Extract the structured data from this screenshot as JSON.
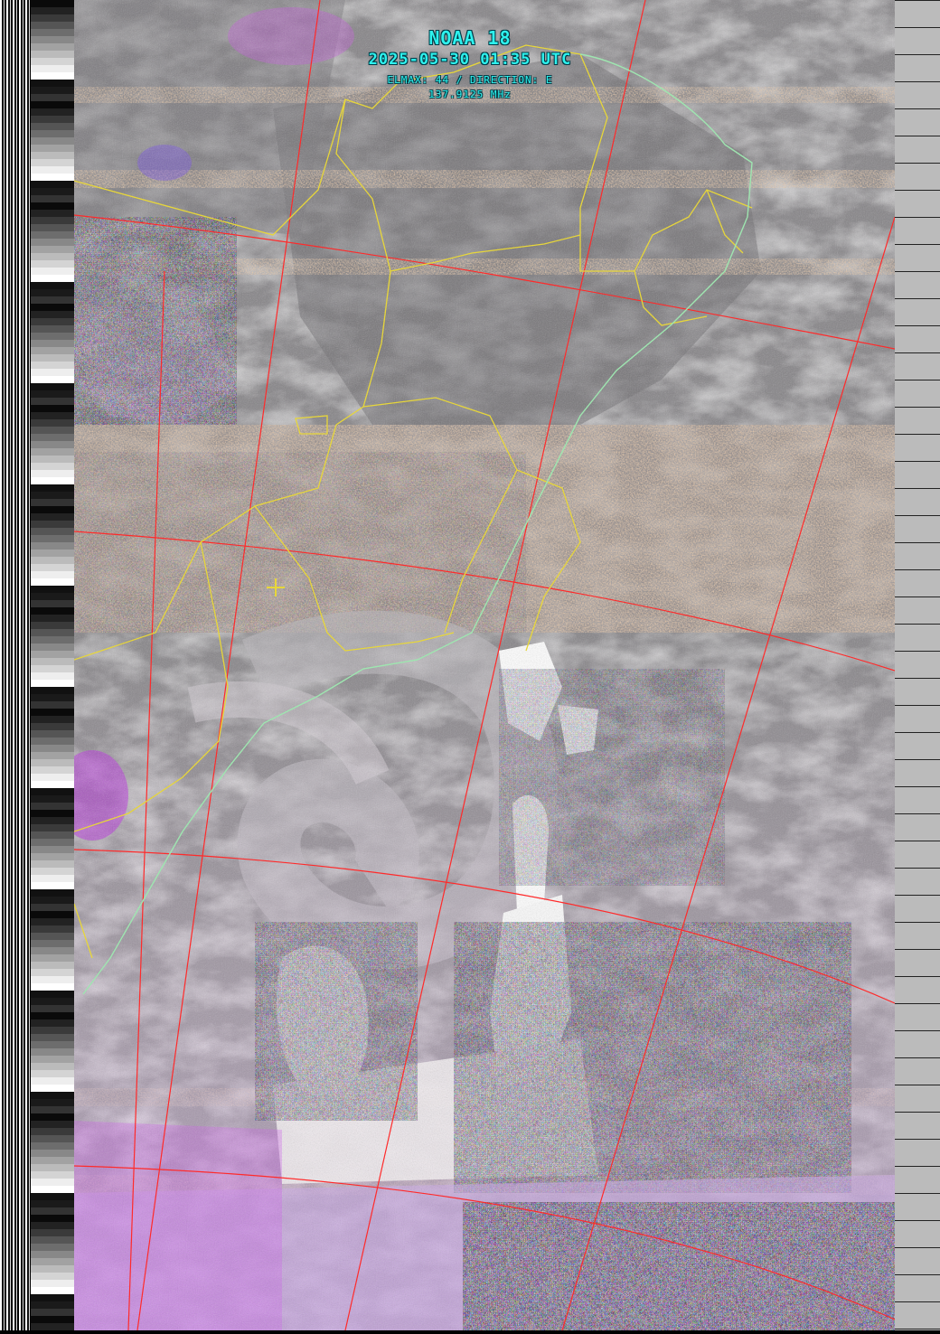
{
  "header": {
    "satellite": "NOAA 18",
    "datetime": "2025-05-30 01:35 UTC",
    "pass_info": "ELMAX: 44 / DIRECTION: E",
    "frequency": "137.9125 MHz"
  },
  "colors": {
    "cloud_bright": "#ffffff",
    "cloud_grey": "#8f8d90",
    "ocean_dark": "#6f6e72",
    "noise_orange": "#c79a6a",
    "palette_magenta": "#d23cff",
    "palette_purple": "#6a2cff",
    "palette_green": "#39c04a",
    "palette_yellow": "#f1e04a",
    "border_yellow": "#e7d63a",
    "coast_green": "#9ee6b0",
    "grid_red": "#ff2a2a",
    "text_cyan": "#2ef2ee"
  },
  "icons": {
    "location_marker": "plus-marker-icon"
  }
}
